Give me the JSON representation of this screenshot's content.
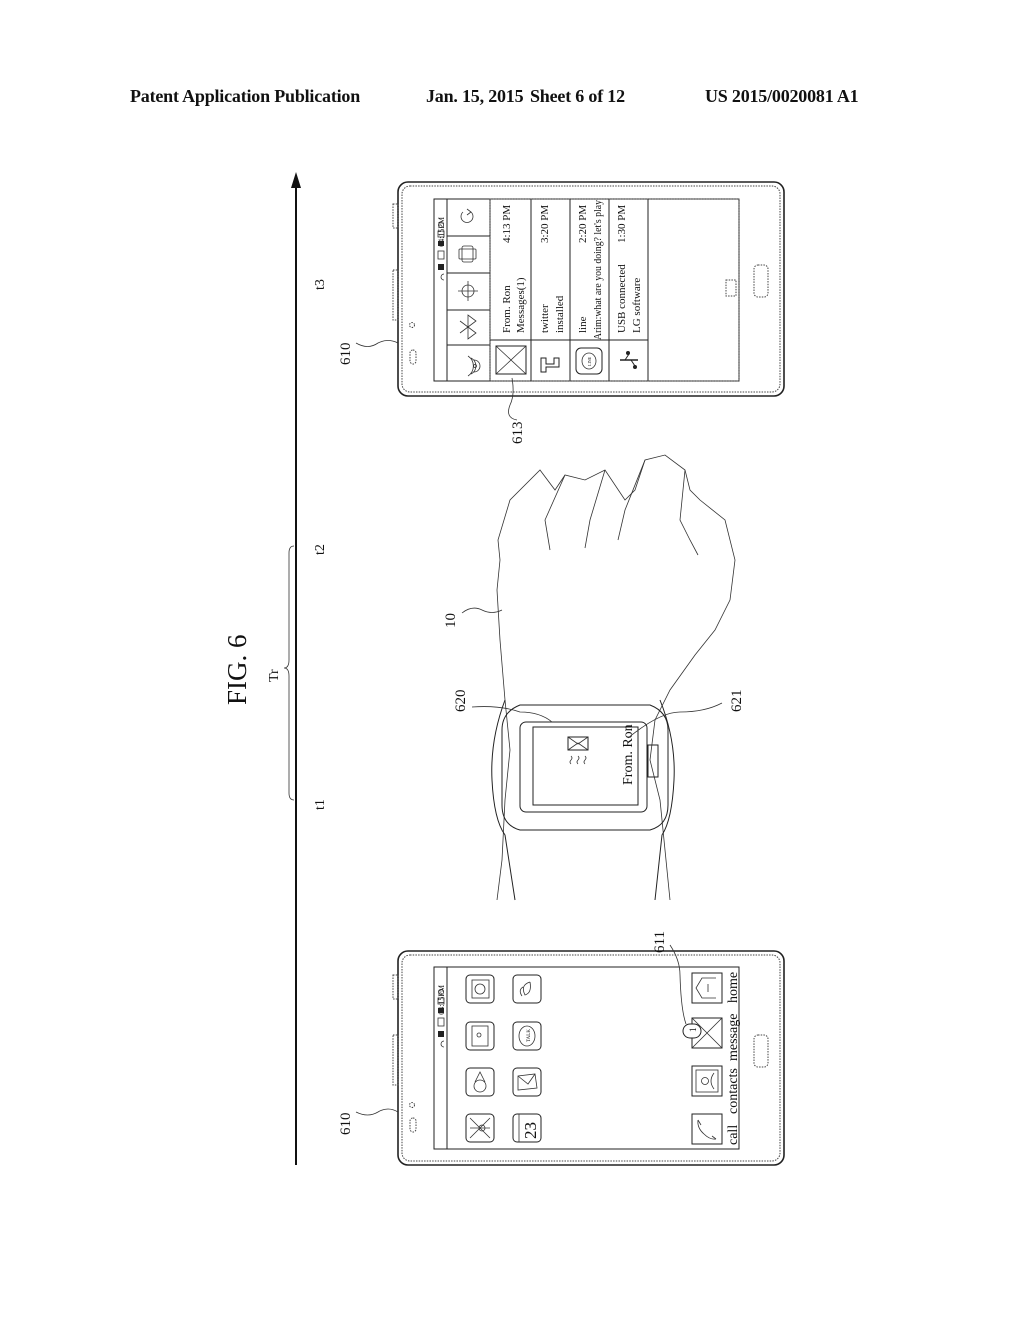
{
  "header": {
    "publication": "Patent Application Publication",
    "date": "Jan. 15, 2015",
    "sheet": "Sheet 6 of 12",
    "patent_number": "US 2015/0020081 A1"
  },
  "figure": {
    "title": "FIG. 6",
    "orientation": "rotated 90° counter-clockwise",
    "timeline": {
      "labels": {
        "t1": "t1",
        "t2": "t2",
        "t3": "t3",
        "range": "Tr"
      }
    },
    "reference_numerals": {
      "phone_left": "610",
      "phone_right": "610",
      "message_badge": "611",
      "notification_icon": "613",
      "wrist": "10",
      "watch": "620",
      "watch_display": "621"
    },
    "home_screen": {
      "status_time": "04:15PM",
      "app_icons": [
        "map-icon",
        "pin-icon",
        "tv-icon",
        "camera-icon",
        "calendar-icon",
        "mail-open-icon",
        "talk-icon",
        "plant-icon"
      ],
      "calendar_day": "23",
      "talk_label": "TALK",
      "dock": [
        {
          "label": "call",
          "icon": "phone-icon"
        },
        {
          "label": "contacts",
          "icon": "contacts-icon"
        },
        {
          "label": "message",
          "icon": "envelope-icon",
          "badge": "1"
        },
        {
          "label": "home",
          "icon": "home-icon"
        }
      ]
    },
    "notification_screen": {
      "status_time": "04:15PM",
      "quick_settings": [
        "wifi-icon",
        "bluetooth-icon",
        "gps-icon",
        "rotate-icon",
        "sync-icon"
      ],
      "notifications": [
        {
          "icon": "envelope-icon",
          "title": "From. Ron",
          "subtitle": "Messages(1)",
          "time": "4:13 PM"
        },
        {
          "icon": "twitter-icon",
          "title": "twitter",
          "subtitle": "installed",
          "time": "3:20 PM"
        },
        {
          "icon": "line-icon",
          "title": "line",
          "subtitle": "Arim:what are you doing? let's play",
          "time": "2:20 PM",
          "icon_text": "LINE"
        },
        {
          "icon": "usb-icon",
          "title": "USB connected",
          "subtitle": "LG software",
          "time": "1:30 PM"
        }
      ]
    },
    "watch_screen": {
      "text": "From. Ron",
      "icon": "envelope-icon"
    }
  }
}
